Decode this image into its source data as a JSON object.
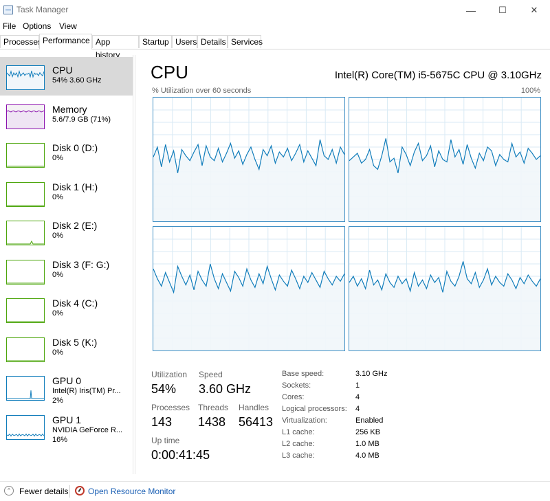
{
  "window": {
    "title": "Task Manager",
    "minimize": "—",
    "maximize": "☐",
    "close": "✕"
  },
  "menu": [
    "File",
    "Options",
    "View"
  ],
  "tabs": [
    "Processes",
    "Performance",
    "App history",
    "Startup",
    "Users",
    "Details",
    "Services"
  ],
  "sidebar": [
    {
      "name": "CPU",
      "line1": "54% 3.60 GHz",
      "line2": "",
      "color": "#117dbb",
      "fill": "#f1f6fa",
      "kind": "cpu"
    },
    {
      "name": "Memory",
      "line1": "5.6/7.9 GB (71%)",
      "line2": "",
      "color": "#8b12ae",
      "fill": "#f4f2f4",
      "kind": "mem"
    },
    {
      "name": "Disk 0 (D:)",
      "line1": "0%",
      "line2": "",
      "color": "#4da60c",
      "fill": "#ffffff",
      "kind": "disk"
    },
    {
      "name": "Disk 1 (H:)",
      "line1": "0%",
      "line2": "",
      "color": "#4da60c",
      "fill": "#ffffff",
      "kind": "disk"
    },
    {
      "name": "Disk 2 (E:)",
      "line1": "0%",
      "line2": "",
      "color": "#4da60c",
      "fill": "#ffffff",
      "kind": "disk2"
    },
    {
      "name": "Disk 3 (F: G:)",
      "line1": "0%",
      "line2": "",
      "color": "#4da60c",
      "fill": "#ffffff",
      "kind": "disk"
    },
    {
      "name": "Disk 4 (C:)",
      "line1": "0%",
      "line2": "",
      "color": "#4da60c",
      "fill": "#ffffff",
      "kind": "disk"
    },
    {
      "name": "Disk 5 (K:)",
      "line1": "0%",
      "line2": "",
      "color": "#4da60c",
      "fill": "#ffffff",
      "kind": "disk"
    },
    {
      "name": "GPU 0",
      "line1": "Intel(R) Iris(TM) Pr...",
      "line2": "2%",
      "color": "#117dbb",
      "fill": "#ffffff",
      "kind": "gpu0"
    },
    {
      "name": "GPU 1",
      "line1": "NVIDIA GeForce R...",
      "line2": "16%",
      "color": "#117dbb",
      "fill": "#ffffff",
      "kind": "gpu1"
    }
  ],
  "main": {
    "title": "CPU",
    "cpu_model": "Intel(R) Core(TM) i5-5675C CPU @ 3.10GHz",
    "graph_label": "% Utilization over 60 seconds",
    "graph_max": "100%",
    "accent": "#117dbb",
    "graph_fill": "#f1f6fa",
    "graph_grid": "#d9eaf4"
  },
  "stats": {
    "utilization_label": "Utilization",
    "utilization": "54%",
    "speed_label": "Speed",
    "speed": "3.60 GHz",
    "processes_label": "Processes",
    "processes": "143",
    "threads_label": "Threads",
    "threads": "1438",
    "handles_label": "Handles",
    "handles": "56413",
    "uptime_label": "Up time",
    "uptime": "0:00:41:45"
  },
  "details": [
    {
      "k": "Base speed:",
      "v": "3.10 GHz"
    },
    {
      "k": "Sockets:",
      "v": "1"
    },
    {
      "k": "Cores:",
      "v": "4"
    },
    {
      "k": "Logical processors:",
      "v": "4"
    },
    {
      "k": "Virtualization:",
      "v": "Enabled"
    },
    {
      "k": "L1 cache:",
      "v": "256 KB"
    },
    {
      "k": "L2 cache:",
      "v": "1.0 MB"
    },
    {
      "k": "L3 cache:",
      "v": "4.0 MB"
    }
  ],
  "footer": {
    "fewer_details": "Fewer details",
    "open_resmon": "Open Resource Monitor"
  },
  "core_graphs": [
    {
      "name": "core-0",
      "values": [
        52,
        60,
        44,
        62,
        48,
        57,
        39,
        58,
        53,
        49,
        56,
        62,
        45,
        61,
        52,
        49,
        59,
        48,
        55,
        63,
        51,
        57,
        46,
        54,
        60,
        50,
        42,
        58,
        53,
        61,
        47,
        56,
        52,
        59,
        49,
        55,
        62,
        48,
        57,
        51,
        45,
        66,
        53,
        50,
        58,
        47,
        60,
        54
      ]
    },
    {
      "name": "core-1",
      "values": [
        49,
        52,
        55,
        47,
        50,
        58,
        45,
        42,
        53,
        67,
        48,
        51,
        39,
        60,
        54,
        45,
        56,
        63,
        49,
        53,
        61,
        44,
        57,
        50,
        48,
        66,
        52,
        58,
        46,
        62,
        51,
        43,
        55,
        49,
        60,
        57,
        45,
        54,
        50,
        48,
        63,
        52,
        56,
        47,
        59,
        55,
        50,
        53
      ]
    },
    {
      "name": "core-2",
      "values": [
        66,
        58,
        52,
        63,
        55,
        47,
        68,
        60,
        53,
        61,
        49,
        64,
        57,
        52,
        70,
        58,
        50,
        62,
        55,
        48,
        64,
        59,
        52,
        66,
        57,
        51,
        62,
        54,
        68,
        58,
        49,
        61,
        56,
        52,
        65,
        58,
        50,
        60,
        55,
        63,
        57,
        51,
        64,
        58,
        53,
        60,
        56,
        62
      ]
    },
    {
      "name": "core-3",
      "values": [
        55,
        60,
        52,
        58,
        50,
        65,
        53,
        57,
        49,
        62,
        55,
        51,
        60,
        54,
        58,
        48,
        63,
        52,
        57,
        50,
        61,
        55,
        59,
        47,
        64,
        56,
        52,
        60,
        72,
        58,
        54,
        63,
        51,
        57,
        66,
        53,
        60,
        55,
        52,
        62,
        57,
        50,
        59,
        54,
        61,
        56,
        52,
        58
      ]
    }
  ]
}
